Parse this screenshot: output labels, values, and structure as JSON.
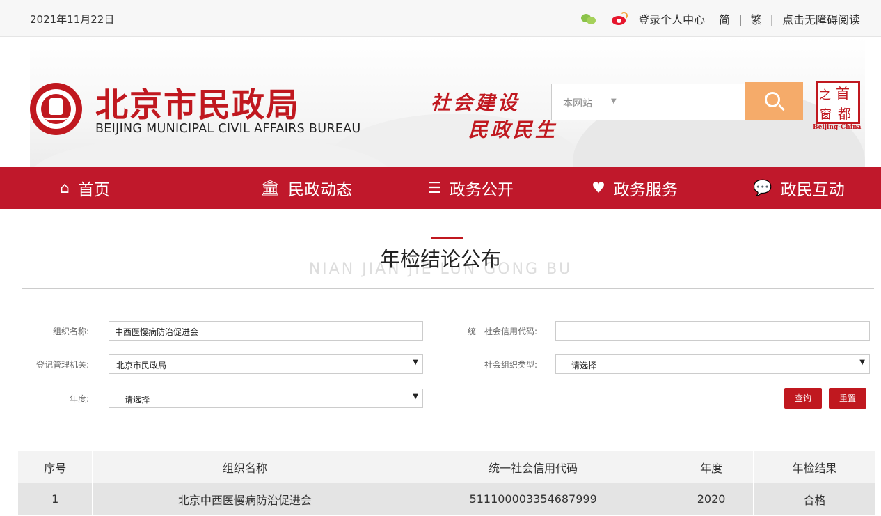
{
  "topbar": {
    "date": "2021年11月22日",
    "login": "登录个人中心",
    "simplified": "简",
    "traditional": "繁",
    "accessible": "点击无障碍阅读",
    "sep1": "|",
    "sep2": "|"
  },
  "banner": {
    "cn_name": "北京市民政局",
    "en_name": "BEIJING MUNICIPAL CIVIL AFFAIRS BUREAU",
    "slogan1": "社会建设",
    "slogan2": "民政民生",
    "search_scope": "本网站",
    "search_arrow": "▼",
    "window_logo": [
      "之",
      "首",
      "窗",
      "都"
    ],
    "window_sub": "Beijing-China"
  },
  "nav": [
    {
      "label": "首页",
      "icon": "home-icon"
    },
    {
      "label": "民政动态",
      "icon": "building-icon"
    },
    {
      "label": "政务公开",
      "icon": "list-icon"
    },
    {
      "label": "政务服务",
      "icon": "heart-icon"
    },
    {
      "label": "政民互动",
      "icon": "chat-icon"
    }
  ],
  "page": {
    "title": "年检结论公布",
    "title_en": "NIAN JIAN JIE LUN GONG BU"
  },
  "form": {
    "org_name_label": "组织名称:",
    "org_name_value": "中西医慢病防治促进会",
    "credit_code_label": "统一社会信用代码:",
    "credit_code_value": "",
    "authority_label": "登记管理机关:",
    "authority_value": "北京市民政局",
    "org_type_label": "社会组织类型:",
    "org_type_value": "—请选择—",
    "year_label": "年度:",
    "year_value": "—请选择—",
    "caret": "▼",
    "query_button": "查询",
    "reset_button": "重置"
  },
  "table": {
    "headers": [
      "序号",
      "组织名称",
      "统一社会信用代码",
      "年度",
      "年检结果"
    ],
    "rows": [
      [
        "1",
        "北京中西医慢病防治促进会",
        "511100003354687999",
        "2020",
        "合格"
      ]
    ]
  }
}
